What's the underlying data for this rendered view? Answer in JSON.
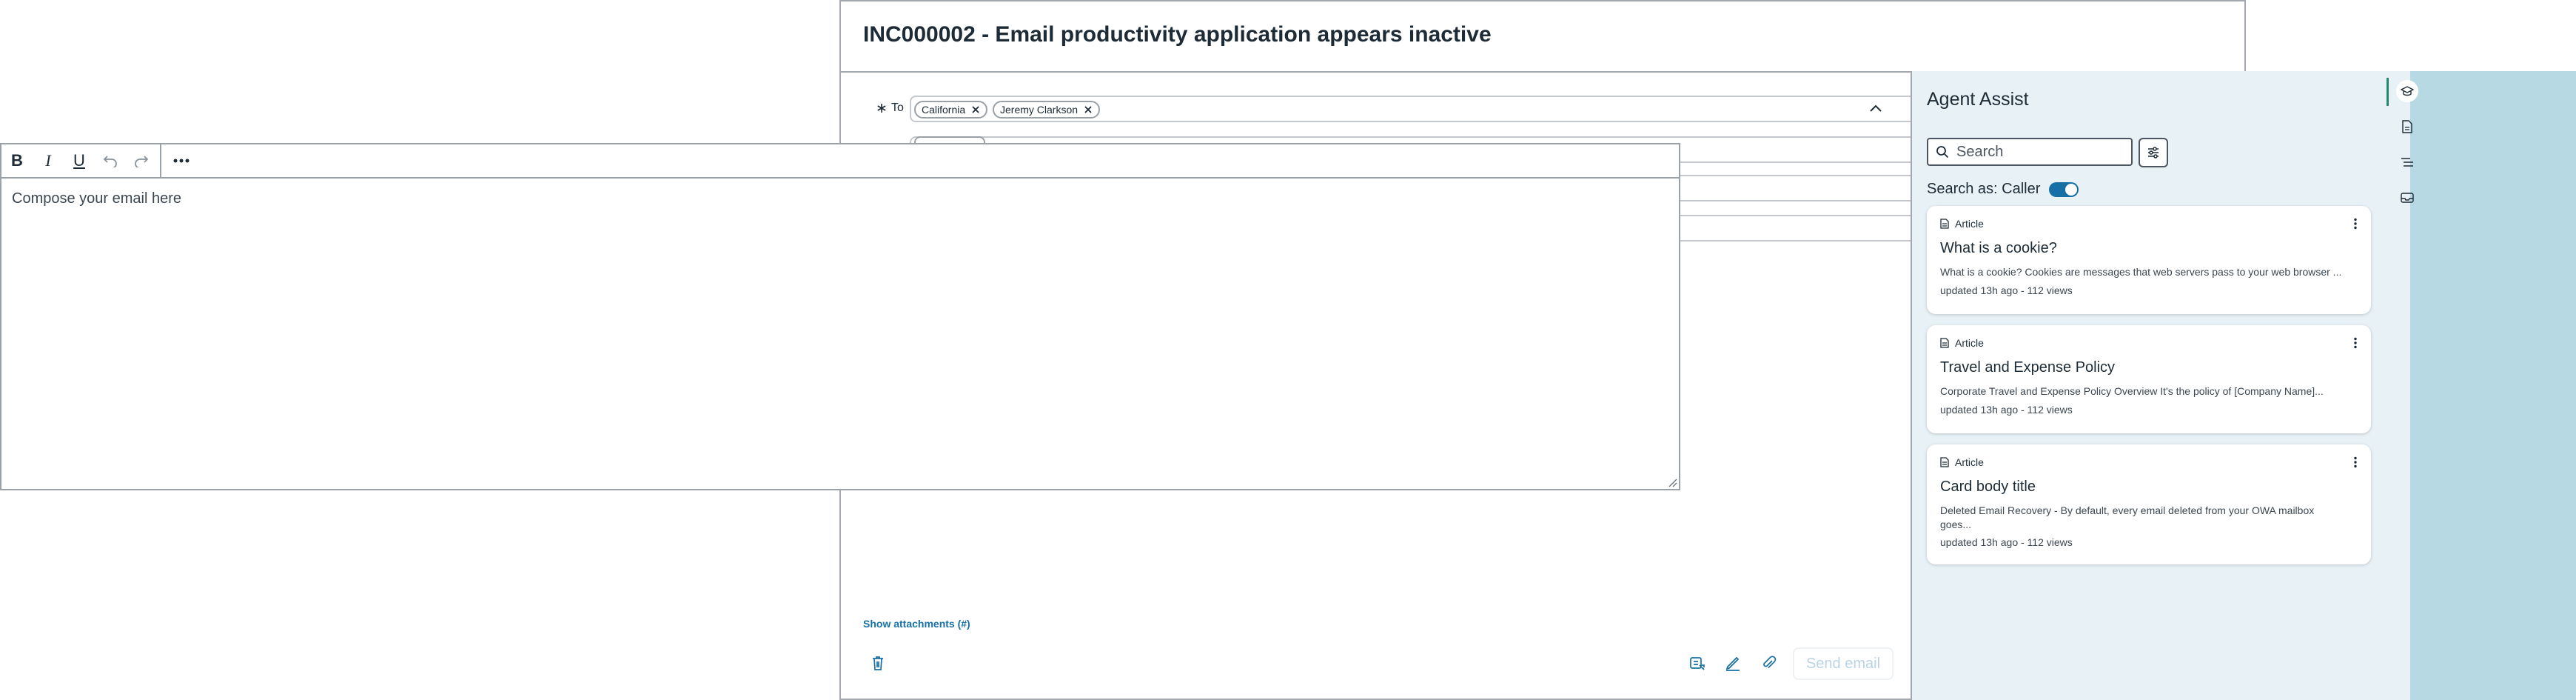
{
  "header": {
    "title": "INC000002 - Email productivity application appears inactive"
  },
  "email_form": {
    "to_label": "To",
    "to_recipients": [
      "California",
      "Jeremy Clarkson"
    ],
    "show_attachments": "Show attachments (#)",
    "send_label": "Send email"
  },
  "composer": {
    "placeholder": "Compose your email here",
    "toolbar": {
      "bold": "B",
      "italic": "I",
      "underline": "U"
    }
  },
  "agent_assist": {
    "title": "Agent Assist",
    "search_placeholder": "Search",
    "search_as_label": "Search as: Caller",
    "cards": [
      {
        "type": "Article",
        "title": "What is a cookie?",
        "body": "What is a cookie? Cookies are messages that web servers pass to your web browser ...",
        "meta": "updated 13h ago - 112 views"
      },
      {
        "type": "Article",
        "title": "Travel and Expense Policy",
        "body": "Corporate Travel and Expense Policy Overview It's the policy of [Company Name]...",
        "meta": "updated 13h ago - 112 views"
      },
      {
        "type": "Article",
        "title": "Card body title",
        "body": "Deleted Email Recovery - By default, every email deleted from your OWA mailbox goes...",
        "meta": "updated 13h ago - 112 views"
      }
    ]
  },
  "icons": {
    "rail": [
      "knowledge-icon",
      "document-icon",
      "list-icon",
      "inbox-icon"
    ]
  },
  "colors": {
    "accent": "#1770a5",
    "panel_bg": "#e7f1f6",
    "rail_bg": "#b7d9e3",
    "active_green": "#1f8a70"
  }
}
